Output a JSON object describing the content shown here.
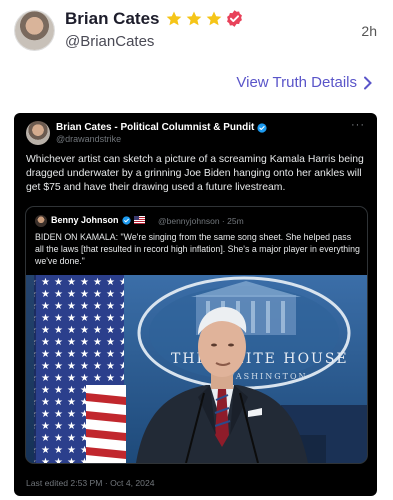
{
  "post": {
    "author_name": "Brian Cates",
    "handle": "@BrianCates",
    "time": "2h",
    "view_details": "View Truth Details"
  },
  "colors": {
    "accent": "#5a55c9",
    "star": "#f5c518",
    "verified_badge": "#e8425a",
    "twitter_verified": "#1d9bf0"
  },
  "icons": [
    "star-icon",
    "verified-badge-icon",
    "chevron-right-icon",
    "more-icon",
    "twitter-verified-icon",
    "flag-icon"
  ],
  "embed": {
    "author": "Brian Cates - Political Columnist & Pundit",
    "handle": "@drawandstrike",
    "more": "···",
    "text": "Whichever artist can sketch a picture of a screaming Kamala Harris being dragged underwater by a grinning Joe Biden hanging onto her ankles will get $75 and have their drawing used a future livestream.",
    "edited": "Last edited 2:53 PM · Oct 4, 2024",
    "quote": {
      "author": "Benny Johnson",
      "handle_time": "@bennyjohnson · 25m",
      "text": "BIDEN ON KAMALA: \"We're singing from the same song sheet. She helped pass all the laws [that resulted in record high inflation]. She's a major player in everything we've done.\"",
      "image_text_1": "THE WHITE HOUSE",
      "image_text_2": "WASHINGTON"
    }
  }
}
